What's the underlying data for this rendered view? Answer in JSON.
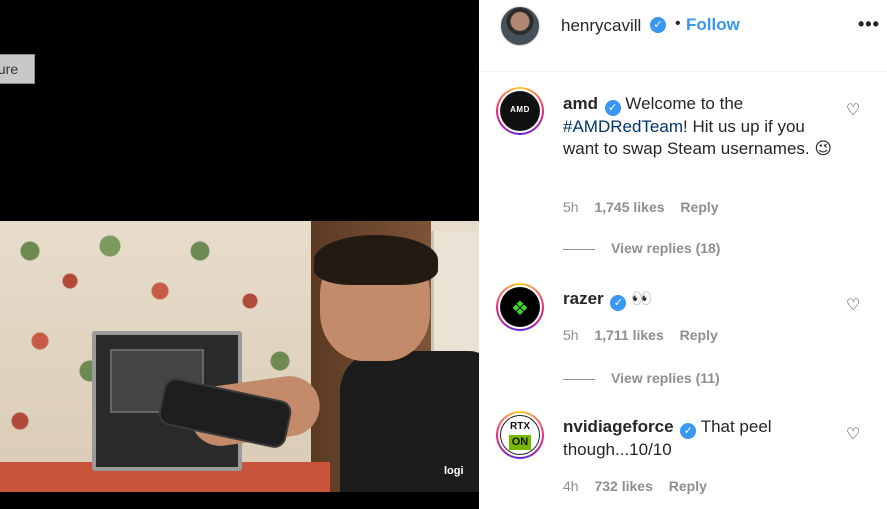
{
  "media": {
    "feature_tag": "ture",
    "watermark": "logi"
  },
  "header": {
    "username": "henrycavill",
    "separator": "•",
    "follow_label": "Follow",
    "more_label": "•••"
  },
  "comments": [
    {
      "author": "amd",
      "avatar_text": "AMD",
      "text_before": " Welcome to the ",
      "hashtag": "#AMDRedTeam",
      "text_after": "! Hit us up if you want to swap Steam usernames. 😉",
      "time": "5h",
      "likes": "1,745 likes",
      "reply": "Reply",
      "view_replies": "View replies (18)"
    },
    {
      "author": "razer",
      "text": " 👀",
      "time": "5h",
      "likes": "1,711 likes",
      "reply": "Reply",
      "view_replies": "View replies (11)"
    },
    {
      "author": "nvidiageforce",
      "avatar_top": "RTX",
      "avatar_bottom": "ON",
      "text": " That peel though...10/10",
      "time": "4h",
      "likes": "732 likes",
      "reply": "Reply"
    }
  ],
  "icons": {
    "verified": "✓",
    "heart": "♡",
    "razer_logo": "❖"
  },
  "colors": {
    "link_blue": "#3897f0",
    "hashtag": "#003569",
    "meta_grey": "#8e8e8e"
  }
}
